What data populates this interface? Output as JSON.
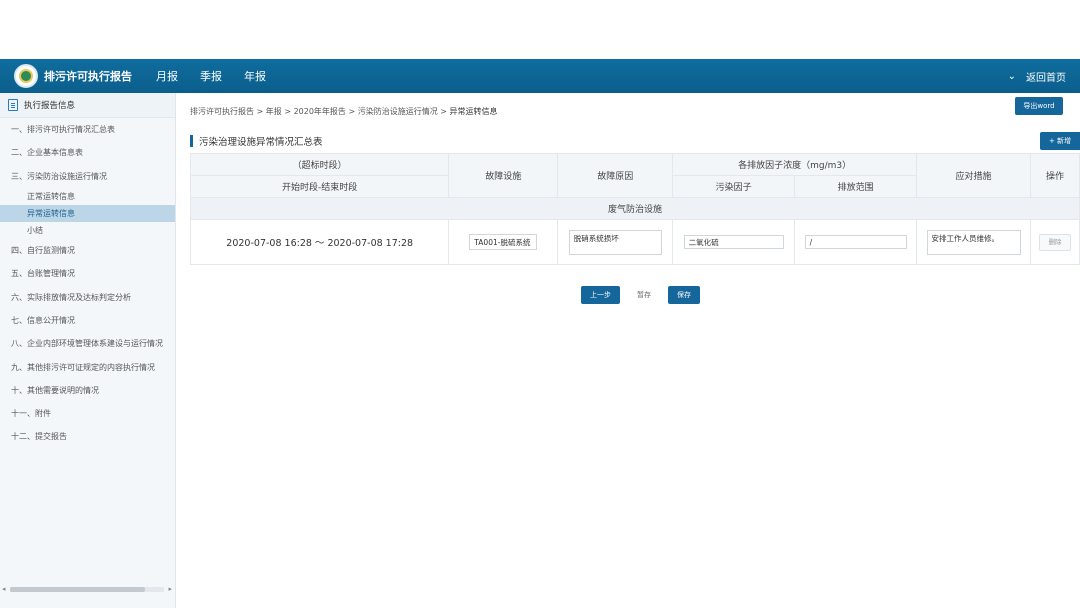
{
  "header": {
    "app_title": "排污许可执行报告",
    "nav": [
      "月报",
      "季报",
      "年报"
    ],
    "dropdown_glyph": "⌄",
    "back_home": "返回首页",
    "logo_icon": "environmental-protection-emblem"
  },
  "sidebar": {
    "header": "执行报告信息",
    "items": [
      {
        "label": "一、排污许可执行情况汇总表"
      },
      {
        "label": "二、企业基本信息表"
      },
      {
        "label": "三、污染防治设施运行情况"
      }
    ],
    "subitems": [
      {
        "label": "正常运转信息"
      },
      {
        "label": "异常运转信息"
      },
      {
        "label": "小结"
      }
    ],
    "items2": [
      {
        "label": "四、自行监测情况"
      },
      {
        "label": "五、台账管理情况"
      },
      {
        "label": "六、实际排放情况及达标判定分析"
      },
      {
        "label": "七、信息公开情况"
      },
      {
        "label": "八、企业内部环境管理体系建设与运行情况"
      },
      {
        "label": "九、其他排污许可证规定的内容执行情况"
      },
      {
        "label": "十、其他需要说明的情况"
      },
      {
        "label": "十一、附件"
      },
      {
        "label": "十二、提交报告"
      }
    ],
    "scroll_left": "◂",
    "scroll_right": "▸"
  },
  "breadcrumb": {
    "path": "排污许可执行报告 > 年报 > 2020年年报告 > 污染防治设施运行情况 > ",
    "current": "异常运转信息"
  },
  "export_button": "导出word",
  "section_title": "污染治理设施异常情况汇总表",
  "add_button": "+ 新增",
  "table": {
    "h_period": "（超标时段）",
    "h_period_sub": "开始时段-结束时段",
    "h_facility": "故障设施",
    "h_reason": "故障原因",
    "h_concentration": "各排放因子浓度（mg/m3）",
    "h_pollutant": "污染因子",
    "h_range": "排放范围",
    "h_measures": "应对措施",
    "h_actions": "操作",
    "group_label": "废气防治设施",
    "row": {
      "period": "2020-07-08 16:28 ～ 2020-07-08 17:28",
      "facility": "TA001-脱硫系统",
      "reason": "脱硝系统损坏",
      "pollutant": "二氧化硫",
      "range": "/",
      "measures": "安排工作人员维修。",
      "delete": "删除"
    }
  },
  "buttons": {
    "prev": "上一步",
    "temp_save": "暂存",
    "save": "保存"
  }
}
